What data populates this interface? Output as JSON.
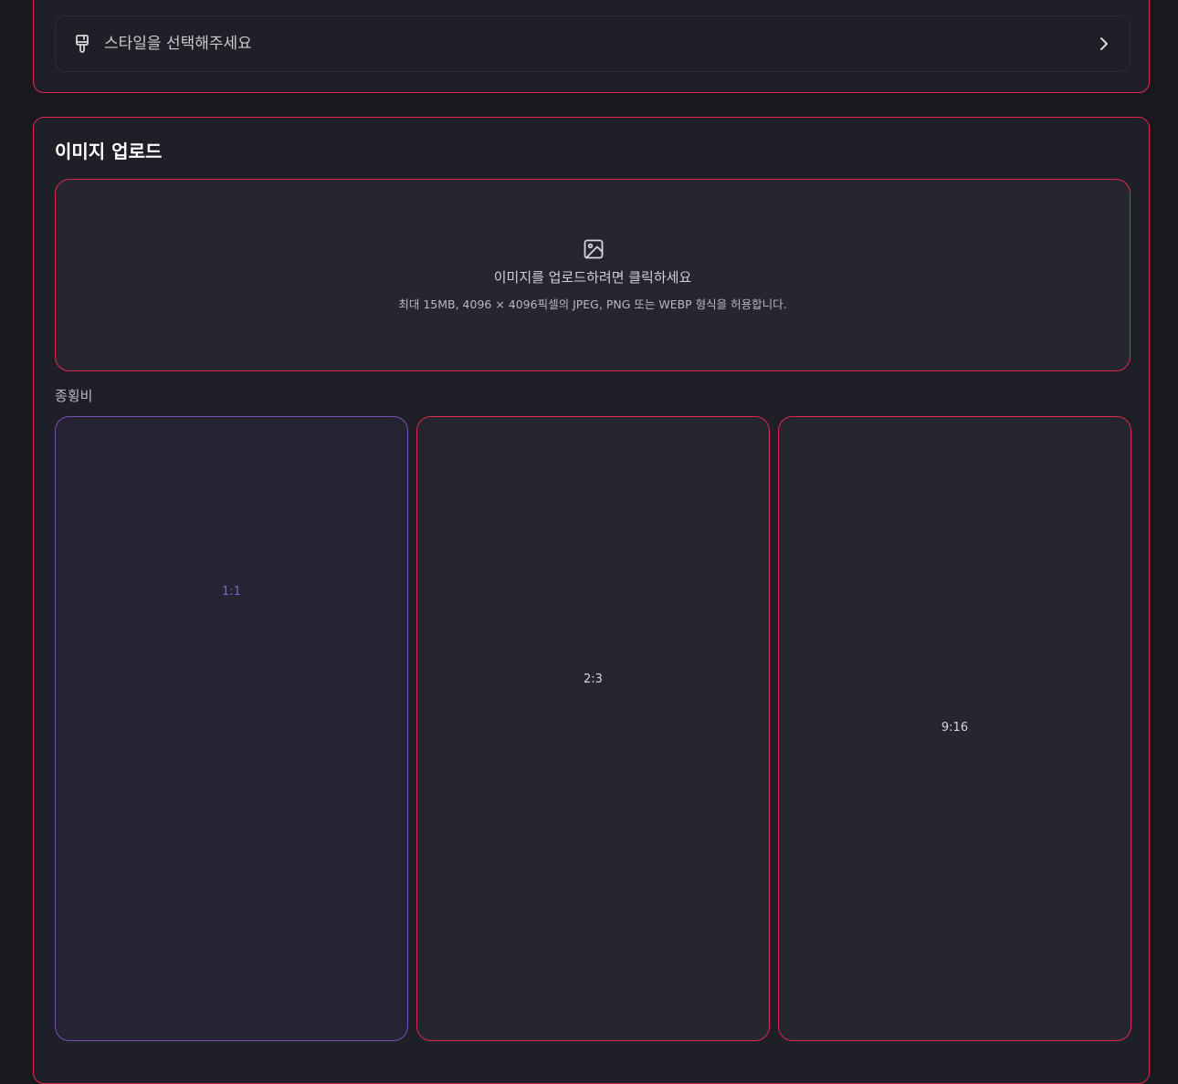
{
  "style_selector": {
    "icon": "paintbrush-icon",
    "placeholder": "스타일을 선택해주세요",
    "chevron": "chevron-right-icon"
  },
  "upload_section": {
    "title": "이미지 업로드",
    "dropzone": {
      "icon": "image-icon",
      "main_text": "이미지를 업로드하려면 클릭하세요",
      "sub_text": "최대 15MB, 4096 × 4096픽셀의 JPEG, PNG 또는 WEBP 형식을 허용합니다."
    }
  },
  "aspect_ratio": {
    "label": "종횡비",
    "selected": "1:1",
    "options": [
      {
        "value": "1:1"
      },
      {
        "value": "2:3"
      },
      {
        "value": "9:16"
      }
    ]
  },
  "colors": {
    "background": "#18191e",
    "panel": "#1f2027",
    "accent_border": "#e0264f",
    "selected_border": "#7b4fb8",
    "selected_text": "#8a5bd0"
  }
}
